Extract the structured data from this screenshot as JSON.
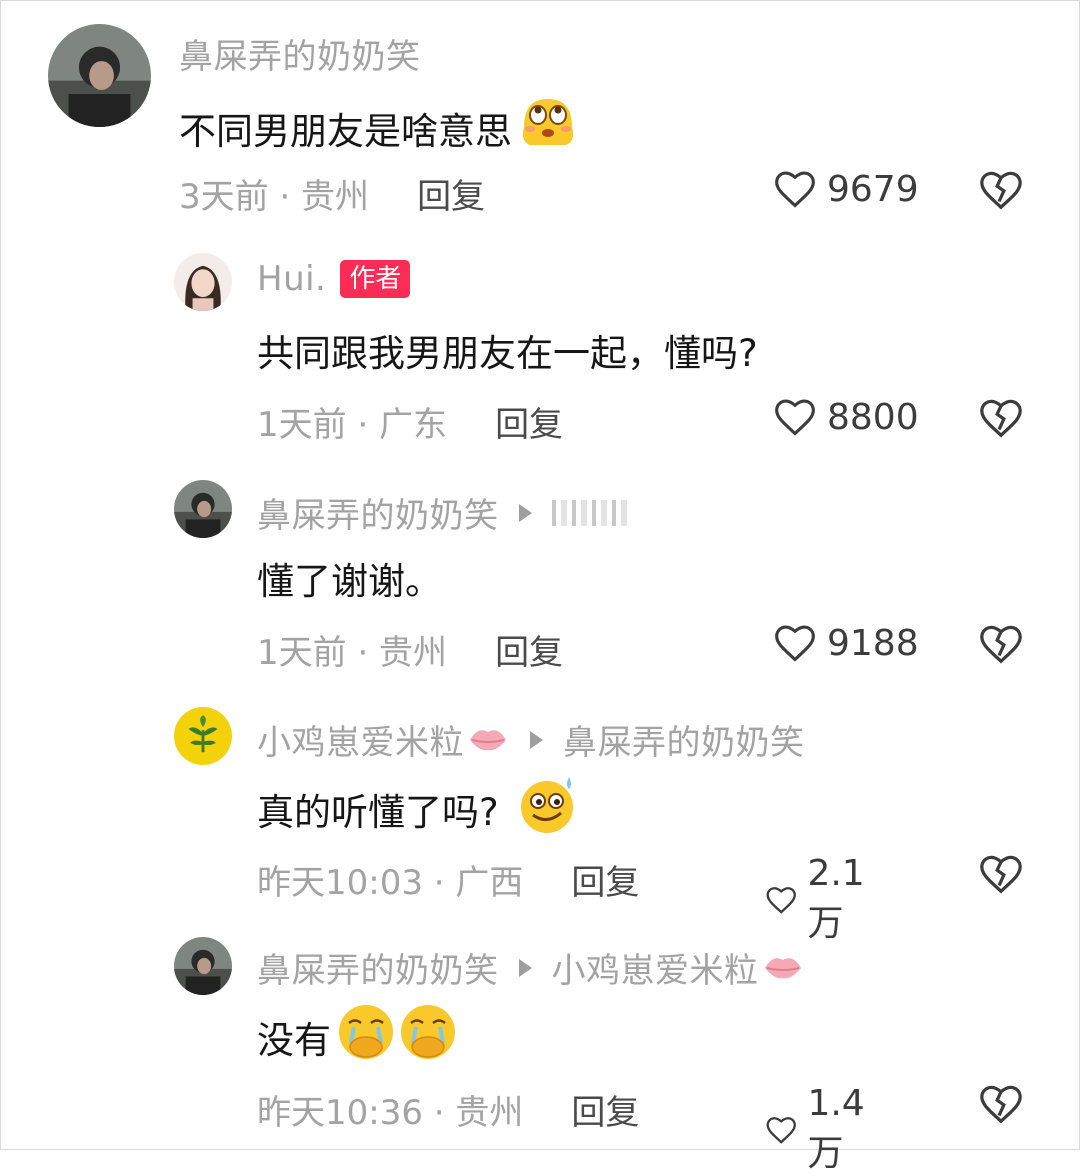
{
  "comments": [
    {
      "name": "鼻屎弄的奶奶笑",
      "text": "不同男朋友是啥意思",
      "emoji": "rolling-eyes-melting-emoji",
      "meta": "3天前 · 贵州",
      "reply": "回复",
      "likes": "9679"
    },
    {
      "name": "Hui.",
      "badge": "作者",
      "text": "共同跟我男朋友在一起，懂吗?",
      "meta": "1天前 · 广东",
      "reply": "回复",
      "likes": "8800"
    },
    {
      "name": "鼻屎弄的奶奶笑",
      "text": "懂了谢谢。",
      "meta": "1天前 · 贵州",
      "reply": "回复",
      "likes": "9188"
    },
    {
      "name": "小鸡崽爱米粒",
      "reply_to": "鼻屎弄的奶奶笑",
      "text": "真的听懂了吗?",
      "emoji": "sweat-smile-emoji",
      "meta": "昨天10:03 · 广西",
      "reply": "回复",
      "likes": "2.1万"
    },
    {
      "name": "鼻屎弄的奶奶笑",
      "reply_to": "小鸡崽爱米粒",
      "text": "没有",
      "emoji": "crying-hands-over-mouth-emoji",
      "meta": "昨天10:36 · 贵州",
      "reply": "回复",
      "likes": "1.4万"
    }
  ],
  "colors": {
    "name_gray": "#a3a3a3",
    "text_black": "#161616",
    "author_badge": "#fb2c55"
  }
}
